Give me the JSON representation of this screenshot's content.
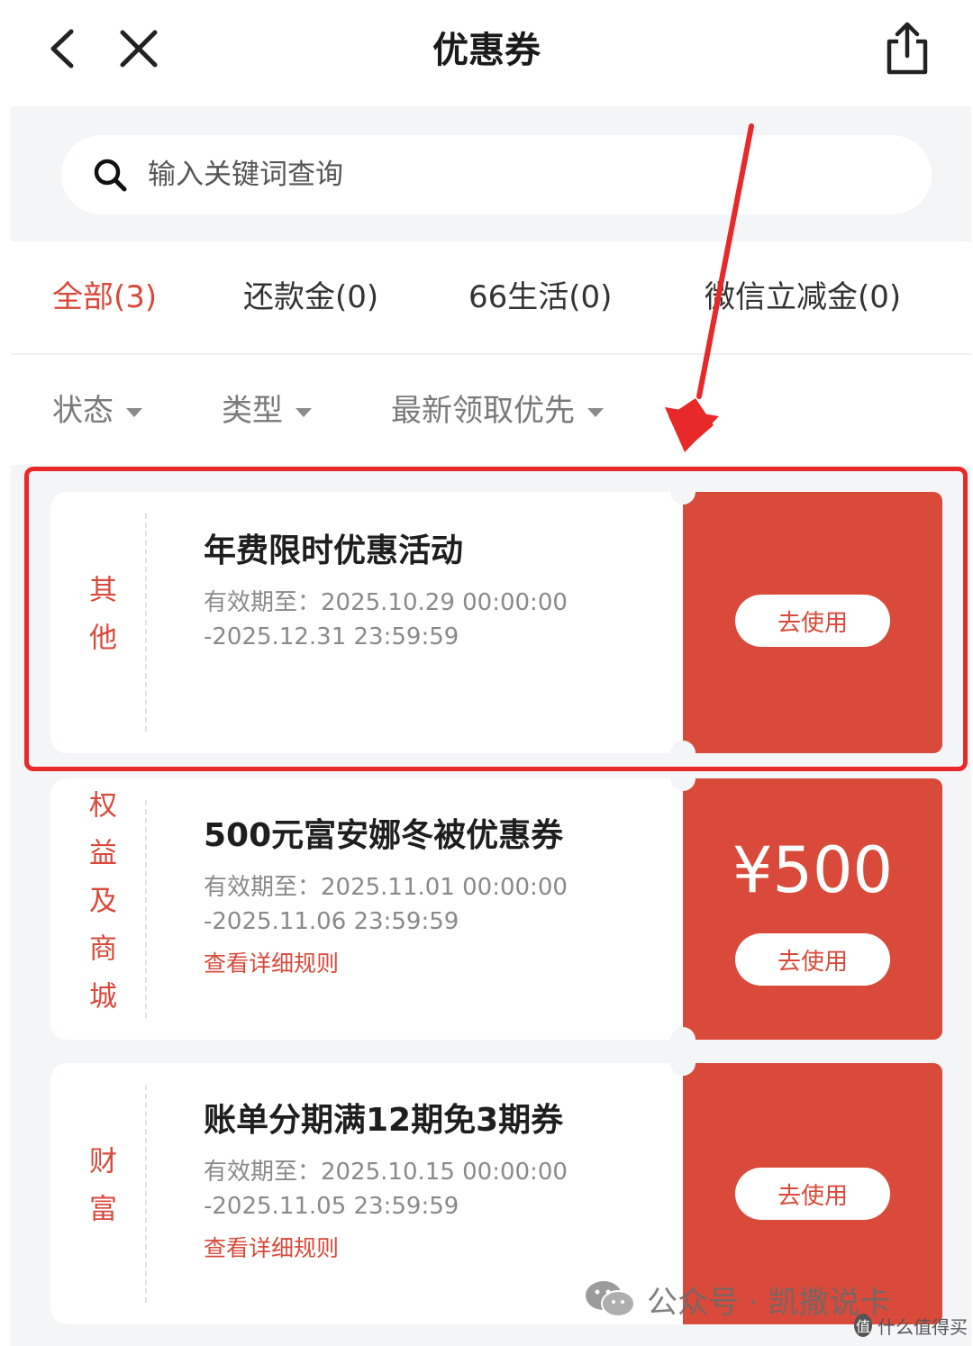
{
  "header": {
    "title": "优惠券",
    "back_icon": "chevron-left-icon",
    "close_icon": "close-icon",
    "share_icon": "share-icon"
  },
  "search": {
    "placeholder": "输入关键词查询",
    "value": ""
  },
  "tabs": [
    {
      "label": "全部(3)",
      "active": true
    },
    {
      "label": "还款金(0)",
      "active": false
    },
    {
      "label": "66生活(0)",
      "active": false
    },
    {
      "label": "微信立减金(0)",
      "active": false
    }
  ],
  "filters": [
    {
      "label": "状态"
    },
    {
      "label": "类型"
    },
    {
      "label": "最新领取优先"
    }
  ],
  "coupons": [
    {
      "category": "其他",
      "title": "年费限时优惠活动",
      "validity_line1": "有效期至：2025.10.29 00:00:00",
      "validity_line2": "-2025.12.31 23:59:59",
      "rules_link": "",
      "amount": "",
      "use_label": "去使用"
    },
    {
      "category": "权益及商城",
      "title": "500元富安娜冬被优惠券",
      "validity_line1": "有效期至：2025.11.01 00:00:00",
      "validity_line2": "-2025.11.06 23:59:59",
      "rules_link": "查看详细规则",
      "amount": "¥500",
      "use_label": "去使用"
    },
    {
      "category": "财富",
      "title": "账单分期满12期免3期券",
      "validity_line1": "有效期至：2025.10.15 00:00:00",
      "validity_line2": "-2025.11.05 23:59:59",
      "rules_link": "查看详细规则",
      "amount": "",
      "use_label": "去使用"
    }
  ],
  "watermark": {
    "text": "公众号 · 凯撒说卡",
    "icon": "wechat-icon"
  },
  "site_mark": {
    "badge": "值",
    "text": "什么值得买"
  },
  "colors": {
    "accent": "#d94a3a",
    "highlight": "#e8292a"
  }
}
